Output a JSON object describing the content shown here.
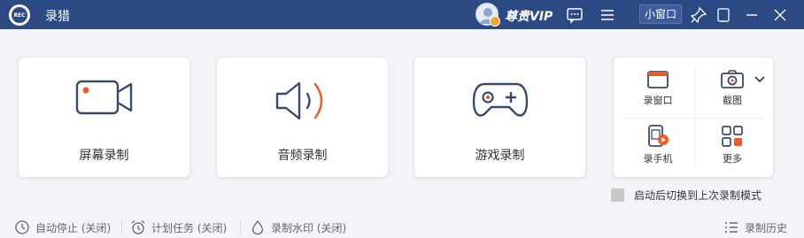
{
  "app": {
    "logo_text": "REC",
    "title": "录猎"
  },
  "titlebar": {
    "vip_label": "尊贵VIP",
    "mini_window_label": "小窗口"
  },
  "modes": [
    {
      "label": "屏幕录制",
      "icon": "screen-record-icon"
    },
    {
      "label": "音频录制",
      "icon": "audio-record-icon"
    },
    {
      "label": "游戏录制",
      "icon": "game-record-icon"
    }
  ],
  "tools": [
    {
      "label": "录窗口",
      "icon": "record-window-icon"
    },
    {
      "label": "截图",
      "icon": "screenshot-icon"
    },
    {
      "label": "录手机",
      "icon": "record-phone-icon"
    },
    {
      "label": "更多",
      "icon": "more-grid-icon"
    }
  ],
  "restore_option": {
    "label": "启动后切换到上次录制模式",
    "checked": false
  },
  "statusbar": {
    "auto_stop": "自动停止 (关闭)",
    "schedule": "计划任务 (关闭)",
    "watermark": "录制水印 (关闭)",
    "history": "录制历史"
  },
  "colors": {
    "titlebar": "#2b4a84",
    "icon_primary": "#3a4a6b",
    "accent": "#f05a22"
  }
}
